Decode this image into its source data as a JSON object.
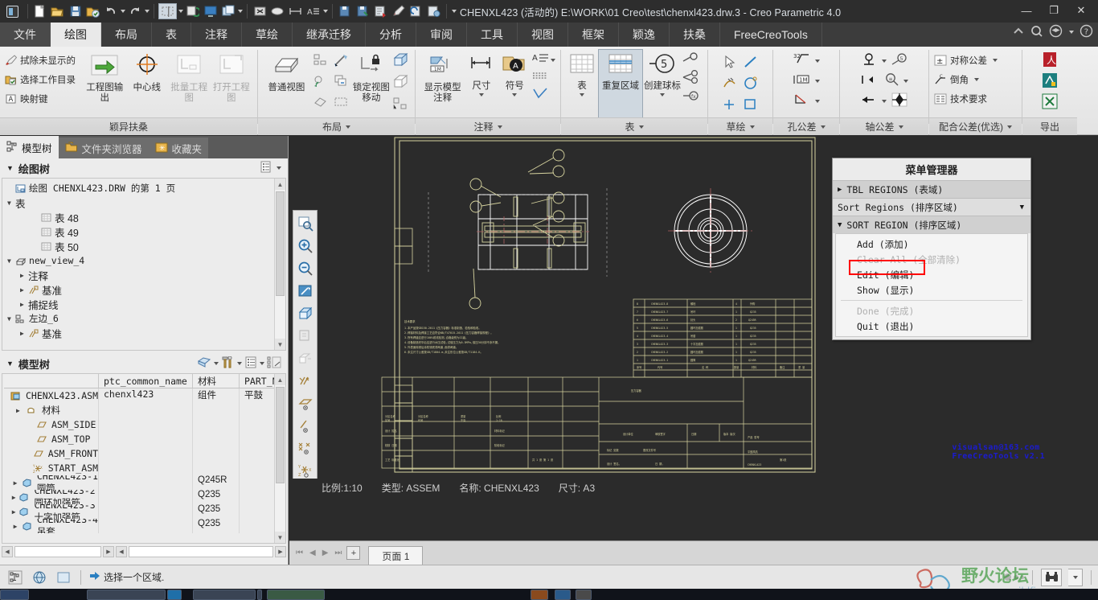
{
  "window": {
    "title": "CHENXL423 (活动的) E:\\WORK\\01 Creo\\test\\chenxl423.drw.3 - Creo Parametric 4.0",
    "minimize": "—",
    "restore": "❐",
    "close": "✕"
  },
  "quick_access": {
    "icons": [
      "new-file-icon",
      "open-folder-icon",
      "save-icon",
      "save-as-icon",
      "undo-icon",
      "redo-icon",
      "selection-icon",
      "regenerate-icon",
      "display-icon",
      "window-icon",
      "close-window-icon",
      "erase-icon",
      "measure-icon",
      "annotate-icon",
      "copy-icon",
      "paste-icon",
      "export-icon",
      "pen-icon",
      "refresh-icon",
      "settings-icon"
    ]
  },
  "ribbon": {
    "tabs": [
      {
        "label": "文件",
        "state": "file"
      },
      {
        "label": "绘图",
        "state": "active"
      },
      {
        "label": "布局",
        "state": "normal"
      },
      {
        "label": "表",
        "state": "normal"
      },
      {
        "label": "注释",
        "state": "normal"
      },
      {
        "label": "草绘",
        "state": "normal"
      },
      {
        "label": "继承迁移",
        "state": "normal"
      },
      {
        "label": "分析",
        "state": "normal"
      },
      {
        "label": "审阅",
        "state": "normal"
      },
      {
        "label": "工具",
        "state": "normal"
      },
      {
        "label": "视图",
        "state": "normal"
      },
      {
        "label": "框架",
        "state": "normal"
      },
      {
        "label": "颖逸",
        "state": "normal"
      },
      {
        "label": "扶桑",
        "state": "normal"
      },
      {
        "label": "FreeCreoTools",
        "state": "normal"
      }
    ],
    "groups": [
      {
        "title": "颖异扶桑",
        "small_items": [
          "拭除未显示的",
          "选择工作目录",
          "映射键"
        ],
        "big_items": [
          {
            "label": "工程图输出",
            "disabled": false
          },
          {
            "label": "中心线",
            "disabled": false
          },
          {
            "label": "批量工程图",
            "disabled": true
          },
          {
            "label": "打开工程图",
            "disabled": true
          }
        ]
      },
      {
        "title": "布局",
        "big_items": [
          {
            "label": "普通视图",
            "disabled": false
          },
          {
            "label": "锁定视图移动",
            "disabled": false
          }
        ]
      },
      {
        "title": "注释",
        "big_items": [
          {
            "label": "显示模型注释",
            "disabled": false
          },
          {
            "label": "尺寸",
            "disabled": false
          },
          {
            "label": "符号",
            "disabled": false
          }
        ]
      },
      {
        "title": "表",
        "big_items": [
          {
            "label": "表",
            "disabled": false
          },
          {
            "label": "重复区域",
            "disabled": false,
            "selected": true
          },
          {
            "label": "创建球标",
            "disabled": false
          }
        ]
      },
      {
        "title": "草绘"
      },
      {
        "title": "孔公差"
      },
      {
        "title": "轴公差"
      },
      {
        "title": "配合公差(优选)",
        "small_items": [
          "对称公差",
          "倒角",
          "技术要求"
        ]
      },
      {
        "title": "导出",
        "export_icons": [
          "pdf-icon",
          "dwg-icon",
          "excel-icon"
        ]
      }
    ]
  },
  "left_panel": {
    "nav_tabs": [
      {
        "label": "模型树",
        "icon": "model-tree-icon",
        "active": true
      },
      {
        "label": "文件夹浏览器",
        "icon": "folder-icon",
        "active": false
      },
      {
        "label": "收藏夹",
        "icon": "star-icon",
        "active": false
      }
    ],
    "drawing_tree": {
      "header": "绘图树",
      "rows": [
        {
          "indent": 0,
          "expander": "",
          "icon": "sheet-icon",
          "label": "绘图 CHENXL423.DRW 的第 1 页"
        },
        {
          "indent": 0,
          "expander": "▼",
          "icon": "",
          "label": "表"
        },
        {
          "indent": 2,
          "expander": "",
          "icon": "table-icon",
          "label": "表 48"
        },
        {
          "indent": 2,
          "expander": "",
          "icon": "table-icon",
          "label": "表 49"
        },
        {
          "indent": 2,
          "expander": "",
          "icon": "table-icon",
          "label": "表 50"
        },
        {
          "indent": 0,
          "expander": "▼",
          "icon": "view-icon",
          "label": "new_view_4"
        },
        {
          "indent": 1,
          "expander": "▶",
          "icon": "",
          "label": "注释"
        },
        {
          "indent": 1,
          "expander": "▶",
          "icon": "datum-icon",
          "label": "基准"
        },
        {
          "indent": 1,
          "expander": "▶",
          "icon": "",
          "label": "捕捉线"
        },
        {
          "indent": 0,
          "expander": "▼",
          "icon": "view2-icon",
          "label": "左边_6"
        },
        {
          "indent": 1,
          "expander": "▶",
          "icon": "datum-icon",
          "label": "基准"
        }
      ]
    },
    "model_tree": {
      "header": "模型树",
      "toolbar_icons": [
        "filter-icon",
        "settings-icon",
        "list-icon",
        "columns-icon"
      ],
      "columns": [
        "",
        "ptc_common_name",
        "材料",
        "PART_N"
      ],
      "rows": [
        {
          "indent": 0,
          "expander": "",
          "icon": "asm-icon",
          "name": "CHENXL423.ASM",
          "common_name": "chenxl423",
          "material": "组件",
          "part_n": "平鼓"
        },
        {
          "indent": 1,
          "expander": "▶",
          "icon": "material-icon",
          "name": "材料",
          "common_name": "",
          "material": "",
          "part_n": ""
        },
        {
          "indent": 2,
          "expander": "",
          "icon": "plane-icon",
          "name": "ASM_SIDE",
          "common_name": "",
          "material": "",
          "part_n": ""
        },
        {
          "indent": 2,
          "expander": "",
          "icon": "plane-icon",
          "name": "ASM_TOP",
          "common_name": "",
          "material": "",
          "part_n": ""
        },
        {
          "indent": 2,
          "expander": "",
          "icon": "plane-icon",
          "name": "ASM_FRONT",
          "common_name": "",
          "material": "",
          "part_n": ""
        },
        {
          "indent": 2,
          "expander": "",
          "icon": "csys-icon",
          "name": "START_ASM",
          "common_name": "",
          "material": "",
          "part_n": ""
        },
        {
          "indent": 1,
          "expander": "▶",
          "icon": "part-icon",
          "name": "CHENXL423-1 圆筒",
          "common_name": "",
          "material": "Q245R",
          "part_n": ""
        },
        {
          "indent": 1,
          "expander": "▶",
          "icon": "part-icon",
          "name": "CHENXL423-2 圆环加强筋",
          "common_name": "",
          "material": "Q235",
          "part_n": ""
        },
        {
          "indent": 1,
          "expander": "▶",
          "icon": "part-icon",
          "name": "CHENXL423-3 十字加强筋",
          "common_name": "",
          "material": "Q235",
          "part_n": ""
        },
        {
          "indent": 1,
          "expander": "▶",
          "icon": "part-icon",
          "name": "CHENXL423-4 吊套",
          "common_name": "",
          "material": "Q235",
          "part_n": ""
        }
      ]
    }
  },
  "graphics": {
    "toolbar_icons": [
      "zoom-fit-icon",
      "zoom-in-icon",
      "zoom-out-icon",
      "repaint-icon",
      "display-style-icon",
      "saved-views-icon",
      "view-manager-icon",
      "datum-display-icon",
      "plane-display-icon",
      "axis-display-icon",
      "point-display-icon",
      "csys-display-icon"
    ],
    "status": {
      "scale": "比例:1:10",
      "type": "类型: ASSEM",
      "name": "名称: CHENXL423",
      "size": "尺寸: A3"
    },
    "watermark": [
      "visualsan@163.com",
      "FreeCreoTools v2.1"
    ],
    "page_tabs": {
      "nav": [
        "⏮",
        "◀",
        "▶",
        "⏭"
      ],
      "add": "+",
      "tabs": [
        "页面 1"
      ]
    }
  },
  "menu_manager": {
    "title": "菜单管理器",
    "sections": [
      {
        "type": "collapsed",
        "expander": "▶",
        "label": "TBL REGIONS (表域)"
      },
      {
        "type": "flat",
        "label": "Sort Regions (排序区域)",
        "caret": "▼"
      },
      {
        "type": "expanded",
        "expander": "▼",
        "label": "SORT REGION (排序区域)"
      }
    ],
    "items": [
      {
        "label": "Add (添加)",
        "disabled": false,
        "highlighted": false
      },
      {
        "label": "Clear All (全部清除)",
        "disabled": true,
        "highlighted": false
      },
      {
        "label": "Edit (编辑)",
        "disabled": false,
        "highlighted": true
      },
      {
        "label": "Show (显示)",
        "disabled": false,
        "highlighted": false
      },
      {
        "label": "Done (完成)",
        "disabled": true,
        "highlighted": false,
        "after_sep": true
      },
      {
        "label": "Quit (退出)",
        "disabled": false,
        "highlighted": false
      }
    ]
  },
  "status_bar": {
    "icons": [
      "selection-filter-icon",
      "globe-icon",
      "window-icon"
    ],
    "message": "选择一个区域.",
    "message_icon": "arrow-right-icon",
    "search_icon": "binoculars-icon",
    "logo_text": "野火论坛",
    "logo_sub": "www.proewildfire.cn"
  },
  "colors": {
    "accent_red": "#ff0000",
    "watermark_blue": "#1b1bd0",
    "drawing_yellow": "#d8d5a0",
    "drawing_white": "#ffffff",
    "titlebar": "#2d2d2d",
    "ribbon": "#ececec"
  }
}
